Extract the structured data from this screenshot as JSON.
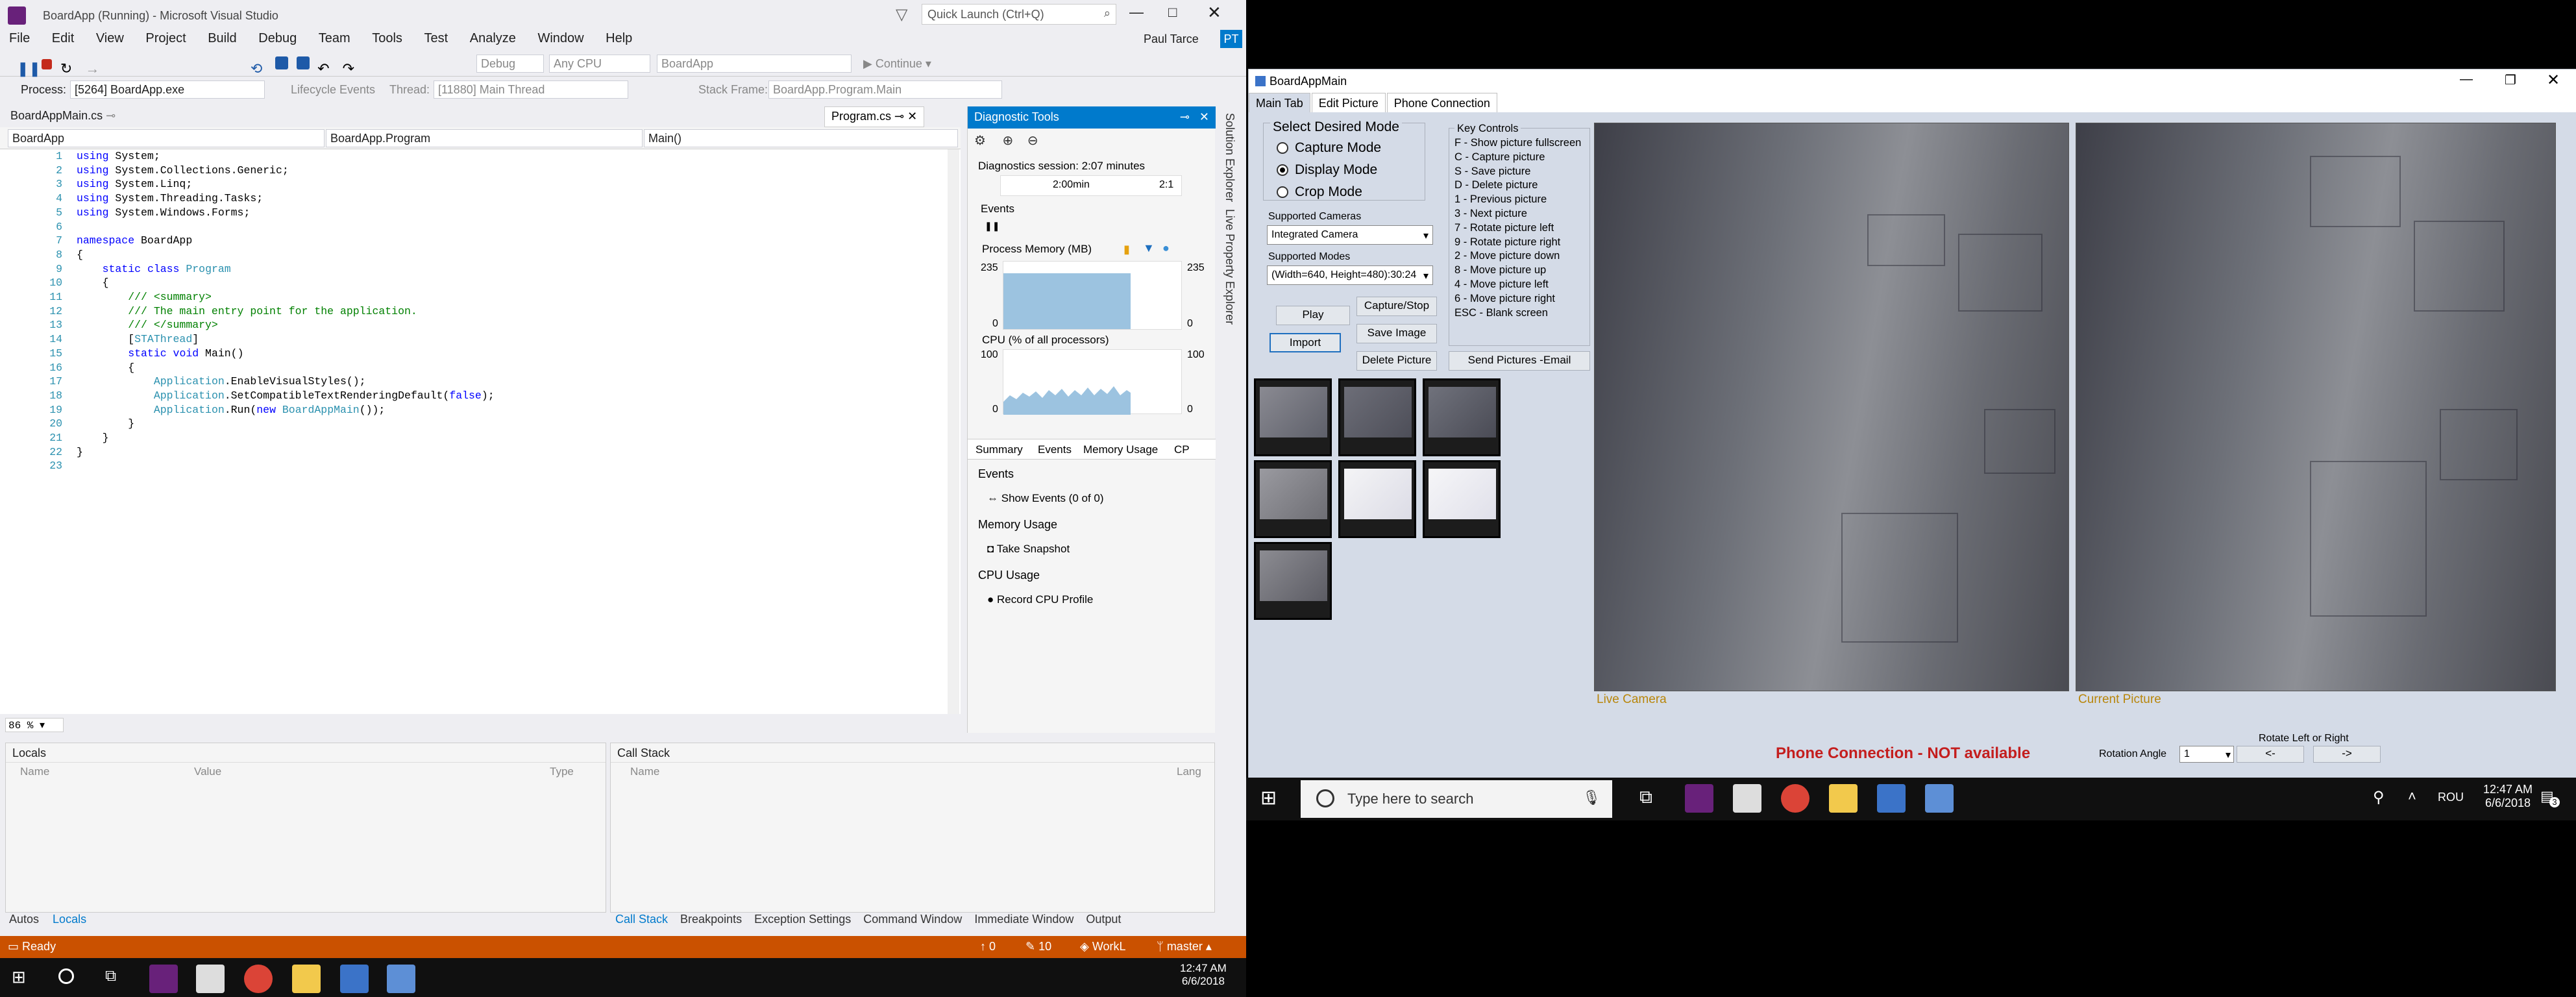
{
  "vs": {
    "title": "BoardApp (Running) - Microsoft Visual Studio",
    "menu": [
      "File",
      "Edit",
      "View",
      "Project",
      "Build",
      "Debug",
      "Team",
      "Tools",
      "Test",
      "Analyze",
      "Window",
      "Help"
    ],
    "quick_launch_placeholder": "Quick Launch (Ctrl+Q)",
    "user": "Paul Tarce",
    "user_initials": "PT",
    "toolbar": {
      "debug_config": "Debug",
      "platform": "Any CPU",
      "project": "BoardApp",
      "continue_label": "Continue"
    },
    "process_bar": {
      "process_label": "Process:",
      "process_value": "[5264] BoardApp.exe",
      "lifecycle": "Lifecycle Events",
      "thread_label": "Thread:",
      "thread_value": "[11880] Main Thread",
      "stack_label": "Stack Frame:",
      "stack_value": "BoardApp.Program.Main"
    },
    "editor_tab": "BoardAppMain.cs",
    "editor_tab2": "Program.cs",
    "nav": {
      "project": "BoardApp",
      "class": "BoardApp.Program",
      "member": "Main()"
    },
    "zoom": "86 %",
    "code_lines": [
      "using System;",
      "using System.Collections.Generic;",
      "using System.Linq;",
      "using System.Threading.Tasks;",
      "using System.Windows.Forms;",
      "",
      "namespace BoardApp",
      "{",
      "    static class Program",
      "    {",
      "        /// <summary>",
      "        /// The main entry point for the application.",
      "        /// </summary>",
      "        [STAThread]",
      "        static void Main()",
      "        {",
      "            Application.EnableVisualStyles();",
      "            Application.SetCompatibleTextRenderingDefault(false);",
      "            Application.Run(new BoardAppMain());",
      "        }",
      "    }",
      "}",
      ""
    ],
    "diag": {
      "title": "Diagnostic Tools",
      "session": "Diagnostics session: 2:07 minutes",
      "time_tick": "2:00min",
      "time_tick2": "2:1",
      "events": "Events",
      "mem_title": "Process Memory (MB)",
      "mem_max": "235",
      "mem_min": "0",
      "cpu_title": "CPU (% of all processors)",
      "cpu_max": "100",
      "cpu_min": "0",
      "tabs": [
        "Summary",
        "Events",
        "Memory Usage",
        "CP"
      ],
      "sections": [
        {
          "head": "Events",
          "action": "Show Events (0 of 0)"
        },
        {
          "head": "Memory Usage",
          "action": "Take Snapshot"
        },
        {
          "head": "CPU Usage",
          "action": "Record CPU Profile"
        }
      ]
    },
    "side_tabs": [
      "Solution Explorer",
      "Live Property Explorer"
    ],
    "locals": {
      "title": "Locals",
      "cols": [
        "Name",
        "Value",
        "Type"
      ]
    },
    "callstack": {
      "title": "Call Stack",
      "cols": [
        "Name",
        "Lang"
      ]
    },
    "bottom_tabs_left": [
      "Autos",
      "Locals"
    ],
    "bottom_tabs_right": [
      "Call Stack",
      "Breakpoints",
      "Exception Settings",
      "Command Window",
      "Immediate Window",
      "Output"
    ],
    "status": {
      "ready": "Ready",
      "up": "0",
      "edits": "10",
      "repo": "WorkL",
      "branch": "master"
    },
    "clock": {
      "time": "12:47 AM",
      "date": "6/6/2018"
    }
  },
  "boardapp": {
    "title": "BoardAppMain",
    "tabs": [
      "Main Tab",
      "Edit Picture",
      "Phone Connection"
    ],
    "mode_group": "Select Desired Mode",
    "modes": [
      "Capture Mode",
      "Display Mode",
      "Crop Mode"
    ],
    "selected_mode": "Display Mode",
    "cameras_label": "Supported Cameras",
    "camera_value": "Integrated Camera",
    "modes_label": "Supported Modes",
    "mode_value": "(Width=640, Height=480):30:24",
    "key_controls_title": "Key Controls",
    "key_controls": [
      "F - Show picture fullscreen",
      "C - Capture picture",
      "S - Save picture",
      "D - Delete picture",
      "1 - Previous picture",
      "3 - Next picture",
      "7 - Rotate picture left",
      "9 - Rotate picture right",
      "2 - Move picture down",
      "8 - Move picture up",
      "4 - Move picture left",
      "6 - Move picture right",
      "ESC - Blank screen"
    ],
    "buttons": {
      "play": "Play",
      "capture_stop": "Capture/Stop",
      "import": "Import",
      "save_image": "Save Image",
      "delete_picture": "Delete Picture",
      "send_pictures": "Send Pictures -Email"
    },
    "live_label": "Live Camera",
    "current_label": "Current Picture",
    "phone_status": "Phone Connection - NOT available",
    "rotate_label": "Rotate Left or Right",
    "rotation_angle_label": "Rotation Angle",
    "rotation_angle_value": "1",
    "left_btn": "<-",
    "right_btn": "->"
  },
  "win_taskbar": {
    "search_placeholder": "Type here to search",
    "lang": "ROU",
    "time": "12:47 AM",
    "date": "6/6/2018",
    "notifications": "3"
  }
}
